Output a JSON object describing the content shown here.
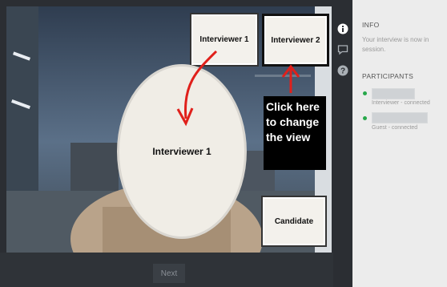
{
  "controls": {
    "next_label": "Next"
  },
  "video": {
    "interviewer1_thumb": "Interviewer 1",
    "interviewer2_thumb": "Interviewer 2",
    "main_label": "Interviewer 1",
    "candidate_thumb": "Candidate",
    "annotation_lines": [
      "Click here",
      "to change",
      "the view"
    ]
  },
  "sidebar": {
    "info_heading": "INFO",
    "info_text": "Your interview is now in session.",
    "participants_heading": "PARTICIPANTS",
    "participants": [
      {
        "role": "Interviewer - connected",
        "status_color": "#27a84a"
      },
      {
        "role": "Guest - connected",
        "status_color": "#27a84a"
      }
    ]
  },
  "icons": [
    "info-icon",
    "chat-icon",
    "help-icon"
  ],
  "colors": {
    "annotation_arrow": "#e0201b",
    "status_connected": "#27a84a"
  }
}
